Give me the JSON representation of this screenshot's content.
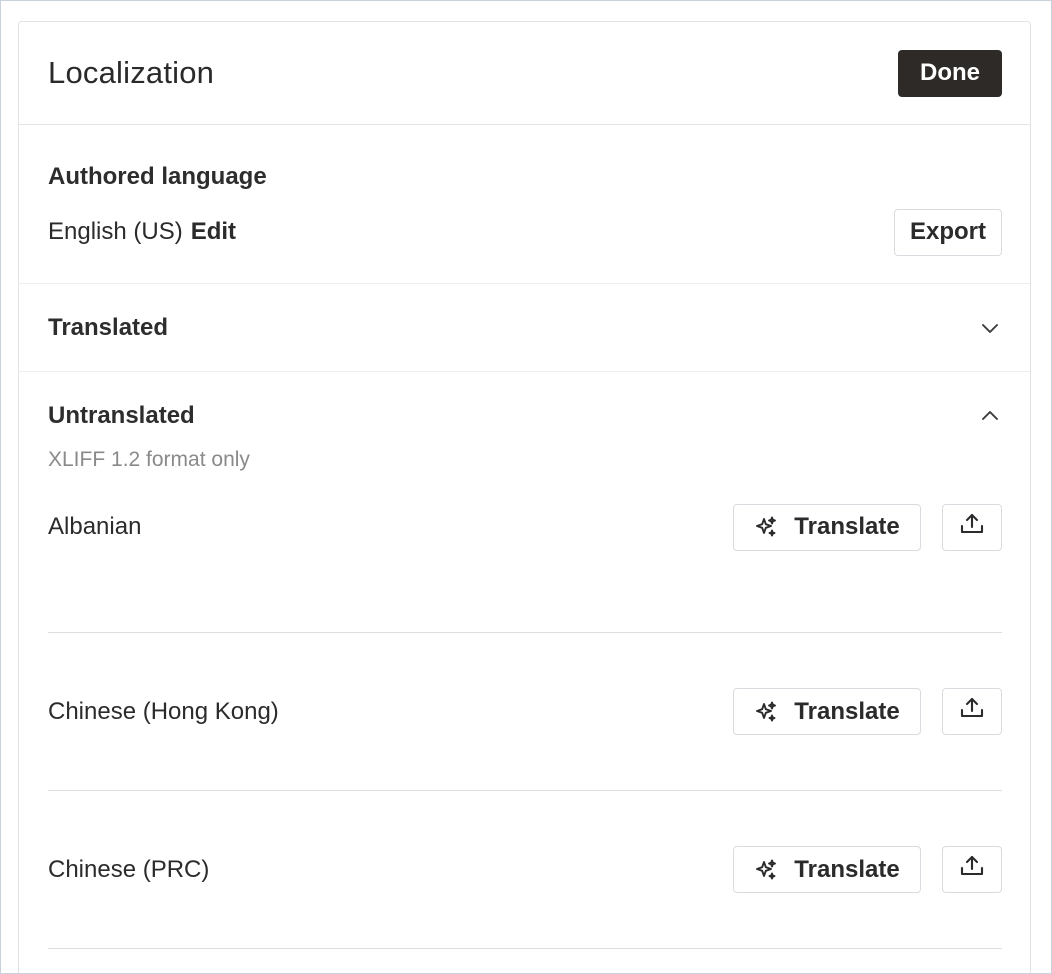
{
  "header": {
    "title": "Localization",
    "done_label": "Done"
  },
  "authored": {
    "heading": "Authored language",
    "language": "English (US)",
    "edit_label": "Edit",
    "export_label": "Export"
  },
  "translated": {
    "heading": "Translated",
    "expanded": false
  },
  "untranslated": {
    "heading": "Untranslated",
    "expanded": true,
    "format_note": "XLIFF 1.2 format only",
    "translate_label": "Translate",
    "languages": [
      {
        "name": "Albanian"
      },
      {
        "name": "Chinese (Hong Kong)"
      },
      {
        "name": "Chinese (PRC)"
      }
    ]
  },
  "icons": {
    "translate": "sparkles-icon",
    "upload": "upload-icon",
    "collapsed": "chevron-down-icon",
    "expanded": "chevron-up-icon"
  }
}
